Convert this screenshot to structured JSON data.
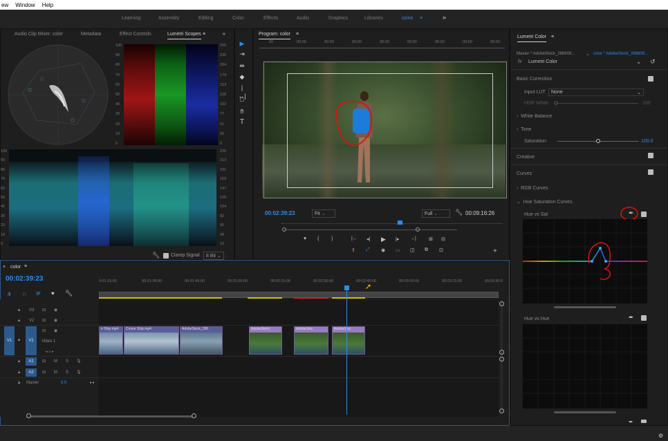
{
  "menubar": {
    "items": [
      "ew",
      "Window",
      "Help"
    ]
  },
  "workspaces": {
    "items": [
      "Learning",
      "Assembly",
      "Editing",
      "Color",
      "Effects",
      "Audio",
      "Graphics",
      "Libraries",
      "szine"
    ],
    "active": "szine",
    "more": "»"
  },
  "scopes_panel": {
    "tabs": [
      "Audio Clip Mixer: color",
      "Metadata",
      "Effect Controls",
      "Lumetri Scopes"
    ],
    "active_tab": "Lumetri Scopes",
    "parade_left_scale": [
      "100",
      "90",
      "80",
      "70",
      "60",
      "50",
      "40",
      "30",
      "20",
      "10",
      "0"
    ],
    "parade_right_scale": [
      "255",
      "230",
      "204",
      "179",
      "153",
      "128",
      "102",
      "77",
      "51",
      "26",
      "0"
    ],
    "wave_left_scale": [
      "100",
      "90",
      "80",
      "70",
      "60",
      "50",
      "40",
      "30",
      "20",
      "10",
      "0"
    ],
    "wave_right_scale": [
      "235",
      "213",
      "191",
      "169",
      "147",
      "126",
      "104",
      "82",
      "60",
      "38",
      "16"
    ],
    "clamp_signal": "Clamp Signal",
    "bit_depth": "8 Bit"
  },
  "program_monitor": {
    "title": "Program: color",
    "ruler": [
      "00",
      "00:00",
      "00:00",
      "00:00",
      "00:00",
      "00:00",
      "00:00",
      "00:00",
      "00:00"
    ],
    "timecode": "00:02:39:23",
    "fit": "Fit",
    "quality": "Full",
    "duration": "00:09:16:26"
  },
  "lumetri": {
    "title": "Lumetri Color",
    "master": "Master * AdobeStock_286608...",
    "clip": "color * AdobeStock_286608...",
    "fx_label": "fx",
    "fx_name": "Lumetri Color",
    "basic_correction": "Basic Correction",
    "input_lut_label": "Input LUT",
    "input_lut_value": "None",
    "hdr_white": "HDR White",
    "hdr_value": "100",
    "white_balance": "White Balance",
    "tone": "Tone",
    "saturation": "Saturation",
    "saturation_value": "100.0",
    "creative": "Creative",
    "curves": "Curves",
    "rgb_curves": "RGB Curves",
    "hue_sat_curves": "Hue Saturation Curves",
    "hue_vs_sat": "Hue vs Sat",
    "hue_vs_hue": "Hue vs Hue"
  },
  "timeline": {
    "title": "color",
    "timecode": "00:02:39:23",
    "ruler": [
      "0:01:15:00",
      "00:01:30:00",
      "00:01:45:00",
      "00:02:00:00",
      "00:02:15:00",
      "00:02:30:00",
      "00:02:45:00",
      "00:03:00:00",
      "00:03:15:00",
      "00:03:30:0"
    ],
    "tracks": {
      "v3": "V3",
      "v2": "V2",
      "v1": "V1",
      "v1_src": "V1",
      "v1_name": "Video 1",
      "a1": "A1",
      "a2": "A2",
      "a1_src": "A1",
      "master": "Master",
      "master_value": "0.0",
      "m": "M",
      "s": "S"
    },
    "clips": [
      {
        "name": "e Ship.mp4"
      },
      {
        "name": "Cruise Ship.mp4"
      },
      {
        "name": "AdobeStock_286"
      },
      {
        "name": "AdobeStock"
      },
      {
        "name": "AdobeStoc"
      },
      {
        "name": "AdobeStoc"
      }
    ]
  },
  "colors": {
    "accent": "#2d8ceb",
    "annotation": "#e01010",
    "menubar": "#ffffff",
    "panel": "#1e1e1e"
  }
}
